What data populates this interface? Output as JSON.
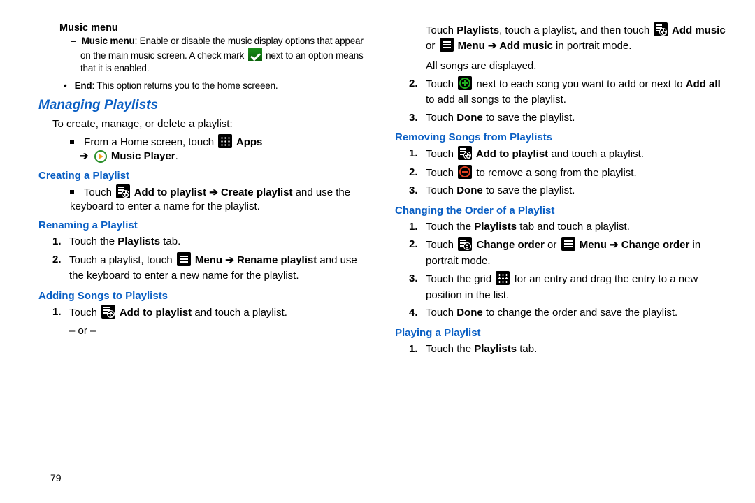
{
  "page_number": "79",
  "left": {
    "music_menu_head": "Music menu",
    "music_menu_item_label": "Music menu",
    "music_menu_item_pre": ": Enable or disable the music display options that appear on the main music screen. A check mark ",
    "music_menu_item_post": " next to an option means that it is enabled.",
    "end_label": "End",
    "end_text": ": This option returns you to the home screeen.",
    "managing": "Managing Playlists",
    "managing_intro": "To create, manage, or delete a playlist:",
    "from_home_pre": "From a Home screen, touch ",
    "apps_label": " Apps",
    "arrow": "➔",
    "music_player_label": " Music Player",
    "creating_head": "Creating a Playlist",
    "creating_pre": "Touch ",
    "creating_bold": " Add to playlist ➔ Create playlist",
    "creating_post": " and use the keyboard to enter a name for the playlist.",
    "renaming_head": "Renaming a Playlist",
    "rename_s1_pre": "Touch the ",
    "rename_s1_bold": "Playlists",
    "rename_s1_post": " tab.",
    "rename_s2_pre": "Touch a playlist, touch ",
    "rename_s2_bold": " Menu ➔ Rename playlist",
    "rename_s2_post": " and use the keyboard to enter a new name for the playlist.",
    "adding_head": "Adding Songs to Playlists",
    "adding_s1_pre": "Touch ",
    "adding_s1_bold": " Add to playlist",
    "adding_s1_post": " and touch a playlist.",
    "adding_or": "– or –"
  },
  "right": {
    "r_top_pre": "Touch ",
    "r_top_bold1": "Playlists",
    "r_top_mid1": ", touch a playlist, and then touch ",
    "r_top_bold2": " Add music",
    "r_top_or": " or ",
    "r_top_bold3": " Menu ➔ Add music",
    "r_top_post": " in portrait mode.",
    "r_allsongs": "All songs are displayed.",
    "r_s2_pre": "Touch ",
    "r_s2_mid": " next to each song you want to add or next to ",
    "r_s2_bold": "Add all",
    "r_s2_post": " to add all songs to the playlist.",
    "r_s3_pre": "Touch ",
    "r_s3_bold": "Done",
    "r_s3_post": " to save the playlist.",
    "remove_head": "Removing Songs from Playlists",
    "rem_s1_pre": "Touch ",
    "rem_s1_bold": " Add to playlist",
    "rem_s1_post": " and touch a playlist.",
    "rem_s2_pre": "Touch ",
    "rem_s2_post": " to remove a song from the playlist.",
    "rem_s3_pre": "Touch ",
    "rem_s3_bold": "Done",
    "rem_s3_post": " to save the playlist.",
    "order_head": "Changing the Order of a Playlist",
    "ord_s1_pre": "Touch the ",
    "ord_s1_bold": "Playlists",
    "ord_s1_post": " tab and touch a playlist.",
    "ord_s2_pre": "Touch ",
    "ord_s2_bold1": " Change order",
    "ord_s2_or": " or ",
    "ord_s2_bold2": " Menu ➔ Change order",
    "ord_s2_post": " in portrait mode.",
    "ord_s3_pre": "Touch the grid ",
    "ord_s3_post": " for an entry and drag the entry to a new position in the list.",
    "ord_s4_pre": "Touch ",
    "ord_s4_bold": "Done",
    "ord_s4_post": " to change the order and save the playlist.",
    "play_head": "Playing a Playlist",
    "play_s1_pre": "Touch the ",
    "play_s1_bold": "Playlists",
    "play_s1_post": " tab."
  }
}
